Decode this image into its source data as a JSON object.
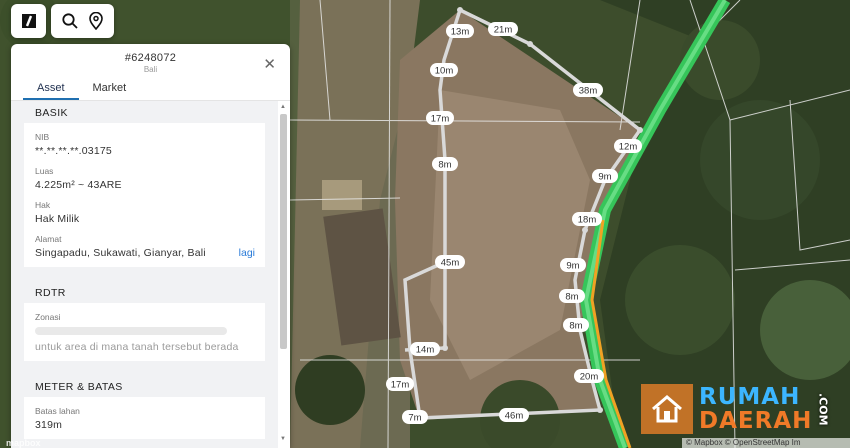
{
  "toolbar": {
    "logo_icon": "app-logo-icon",
    "search_icon": "search-icon",
    "location_icon": "map-pin-icon"
  },
  "panel": {
    "id": "#6248072",
    "region": "Bali",
    "tabs": [
      {
        "label": "Asset",
        "active": true
      },
      {
        "label": "Market",
        "active": false
      }
    ],
    "basik": {
      "title": "BASIK",
      "nib_label": "NIB",
      "nib_value": "**.**.**.**.03175",
      "luas_label": "Luas",
      "luas_value": "4.225m² ~ 43ARE",
      "hak_label": "Hak",
      "hak_value": "Hak Milik",
      "alamat_label": "Alamat",
      "alamat_value": "Singapadu, Sukawati, Gianyar, Bali",
      "alamat_link": "lagi"
    },
    "rdtr": {
      "title": "RDTR",
      "zonasi_label": "Zonasi",
      "zonasi_hint": "untuk area di mana tanah tersebut berada"
    },
    "meter": {
      "title": "METER & BATAS",
      "batas_label": "Batas lahan",
      "batas_value": "319m"
    }
  },
  "map": {
    "distances": [
      "13m",
      "21m",
      "10m",
      "38m",
      "17m",
      "12m",
      "8m",
      "9m",
      "18m",
      "45m",
      "9m",
      "8m",
      "8m",
      "14m",
      "20m",
      "17m",
      "7m",
      "46m"
    ],
    "road_color": "#36c55a",
    "road_edge_color": "#f0a224",
    "boundary_color": "#d9d9d9"
  },
  "watermark": {
    "line1": "RUMAH",
    "line2": "DAERAH",
    "suffix": ".COM"
  },
  "attribution": "© Mapbox © OpenStreetMap Im",
  "mapbox_label": "mapbox"
}
